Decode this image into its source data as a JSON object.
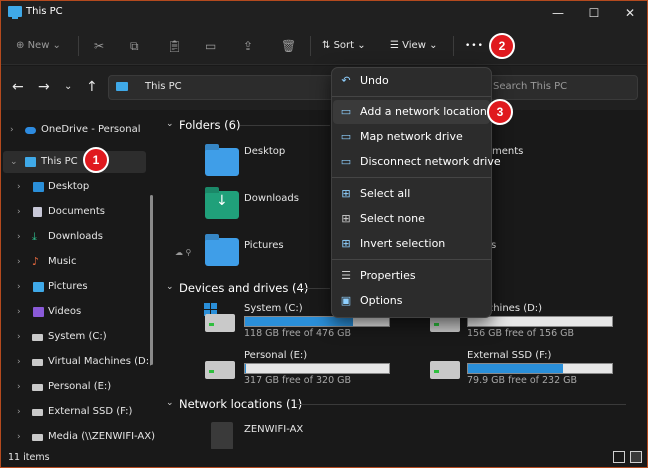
{
  "window": {
    "title": "This PC",
    "minimize": "—",
    "maximize": "☐",
    "close": "✕"
  },
  "toolbar": {
    "new_label": "New",
    "sort_label": "Sort",
    "view_label": "View",
    "more": "•••"
  },
  "address": {
    "location": "This PC",
    "search_placeholder": "Search This PC"
  },
  "sidebar": {
    "items": [
      {
        "label": "OneDrive - Personal"
      },
      {
        "label": "This PC"
      },
      {
        "label": "Desktop"
      },
      {
        "label": "Documents"
      },
      {
        "label": "Downloads"
      },
      {
        "label": "Music"
      },
      {
        "label": "Pictures"
      },
      {
        "label": "Videos"
      },
      {
        "label": "System (C:)"
      },
      {
        "label": "Virtual Machines (D:)"
      },
      {
        "label": "Personal (E:)"
      },
      {
        "label": "External SSD (F:)"
      },
      {
        "label": "Media (\\\\ZENWIFI-AX) ("
      }
    ]
  },
  "folders": {
    "header": "Folders (6)",
    "items": [
      {
        "label": "Desktop"
      },
      {
        "label": "ments"
      },
      {
        "label": "Downloads"
      },
      {
        "label": "Pictures"
      },
      {
        "label": "s"
      }
    ]
  },
  "drives": {
    "header": "Devices and drives (4)",
    "items": [
      {
        "name": "System (C:)",
        "free": "118 GB free of 476 GB",
        "used_fraction": 0.75
      },
      {
        "name": "l Machines (D:)",
        "free": "156 GB free of 156 GB",
        "used_fraction": 0.0
      },
      {
        "name": "Personal (E:)",
        "free": "317 GB free of 320 GB",
        "used_fraction": 0.01
      },
      {
        "name": "External SSD (F:)",
        "free": "79.9 GB free of 232 GB",
        "used_fraction": 0.66
      }
    ]
  },
  "network": {
    "header": "Network locations (1)",
    "items": [
      {
        "label": "ZENWIFI-AX"
      }
    ]
  },
  "context_menu": {
    "items": [
      {
        "label": "Undo"
      },
      {
        "label": "Add a network location"
      },
      {
        "label": "Map network drive"
      },
      {
        "label": "Disconnect network drive"
      },
      {
        "label": "Select all"
      },
      {
        "label": "Select none"
      },
      {
        "label": "Invert selection"
      },
      {
        "label": "Properties"
      },
      {
        "label": "Options"
      }
    ]
  },
  "badges": [
    "1",
    "2",
    "3"
  ],
  "status": {
    "items_count": "11 items"
  },
  "colors": {
    "accent_badge": "#e0191e",
    "drive_bar": "#2a8fd9",
    "frame": "#b44a1e"
  }
}
